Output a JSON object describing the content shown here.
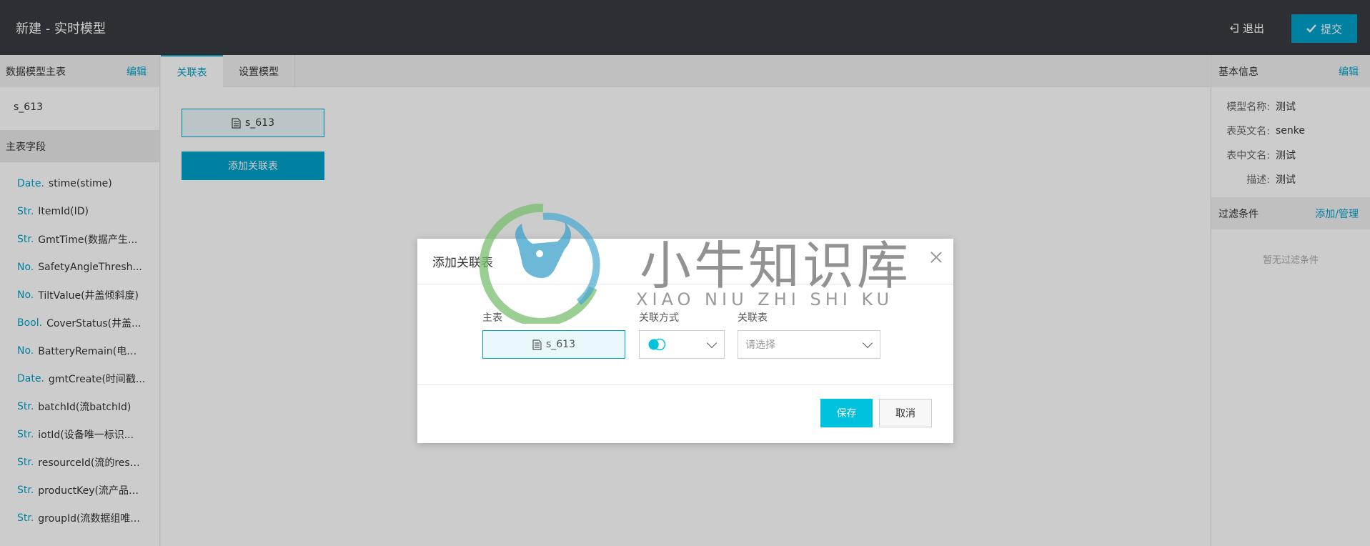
{
  "header": {
    "title": "新建 - 实时模型",
    "exit_label": "退出",
    "submit_label": "提交"
  },
  "left": {
    "title": "数据模型主表",
    "edit_label": "编辑",
    "table_name": "s_613",
    "fields_title": "主表字段",
    "fields": [
      {
        "type": "Date.",
        "name": "stime(stime)"
      },
      {
        "type": "Str.",
        "name": "ItemId(ID)"
      },
      {
        "type": "Str.",
        "name": "GmtTime(数据产生..."
      },
      {
        "type": "No.",
        "name": "SafetyAngleThresh..."
      },
      {
        "type": "No.",
        "name": "TiltValue(井盖倾斜度)"
      },
      {
        "type": "Bool.",
        "name": "CoverStatus(井盖..."
      },
      {
        "type": "No.",
        "name": "BatteryRemain(电池..."
      },
      {
        "type": "Date.",
        "name": "gmtCreate(时间戳..."
      },
      {
        "type": "Str.",
        "name": "batchId(流batchId)"
      },
      {
        "type": "Str.",
        "name": "iotId(设备唯一标识..."
      },
      {
        "type": "Str.",
        "name": "resourceId(流的reso..."
      },
      {
        "type": "Str.",
        "name": "productKey(流产品k..."
      },
      {
        "type": "Str.",
        "name": "groupId(流数据组唯..."
      }
    ]
  },
  "tabs": [
    {
      "label": "关联表"
    },
    {
      "label": "设置模型"
    }
  ],
  "canvas": {
    "node_label": "s_613",
    "add_button": "添加关联表"
  },
  "right": {
    "title": "基本信息",
    "edit_label": "编辑",
    "info": [
      {
        "key": "模型名称:",
        "value": "测试"
      },
      {
        "key": "表英文名:",
        "value": "senke"
      },
      {
        "key": "表中文名:",
        "value": "测试"
      },
      {
        "key": "描述:",
        "value": "测试"
      }
    ],
    "filter_title": "过滤条件",
    "filter_action": "添加/管理",
    "filter_empty": "暂无过滤条件"
  },
  "modal": {
    "title": "添加关联表",
    "main_label": "主表",
    "main_value": "s_613",
    "join_label": "关联方式",
    "rel_label": "关联表",
    "rel_placeholder": "请选择",
    "save_label": "保存",
    "cancel_label": "取消"
  },
  "watermark": {
    "text": "小牛知识库",
    "sub": "XIAO NIU ZHI SHI KU"
  },
  "colors": {
    "accent": "#00a2ca",
    "header_bg": "#373d41",
    "save_bg": "#00c1de"
  }
}
